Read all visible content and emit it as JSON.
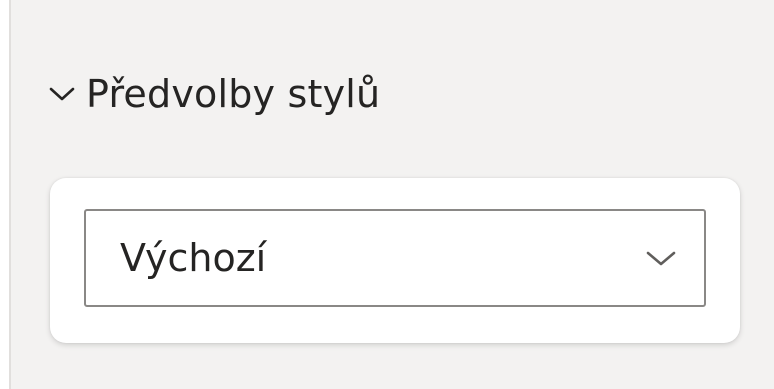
{
  "style_presets": {
    "title": "Předvolby stylů",
    "collapse_icon": "chevron-down-icon",
    "dropdown": {
      "selected_value": "Výchozí",
      "icon": "chevron-down-icon"
    }
  },
  "colors": {
    "pane_background": "#f3f2f1",
    "card_background": "#ffffff",
    "text": "#252423",
    "dropdown_border": "#8a8886"
  }
}
